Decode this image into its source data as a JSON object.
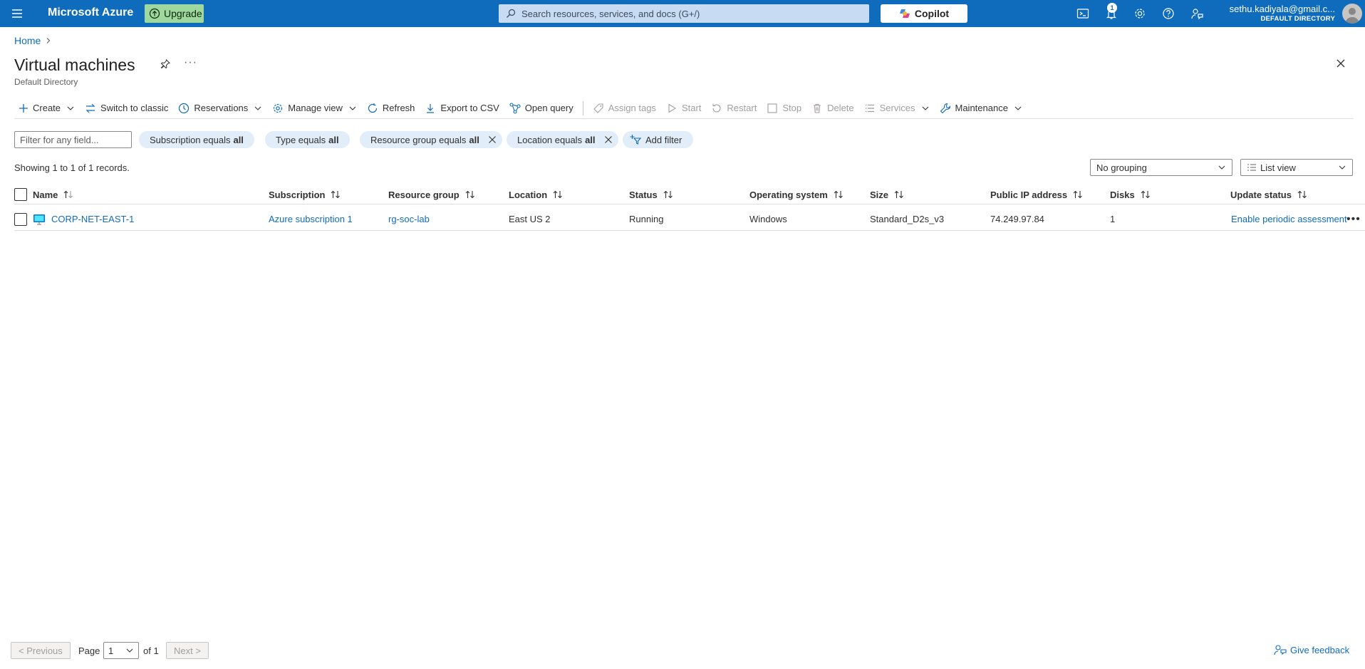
{
  "topbar": {
    "brand": "Microsoft Azure",
    "upgrade_label": "Upgrade",
    "search_placeholder": "Search resources, services, and docs (G+/)",
    "copilot_label": "Copilot",
    "notification_count": "1",
    "account_email": "sethu.kadiyala@gmail.c...",
    "account_directory": "DEFAULT DIRECTORY"
  },
  "breadcrumb": {
    "home": "Home"
  },
  "header": {
    "title": "Virtual machines",
    "subtitle": "Default Directory",
    "more": "···"
  },
  "commands": {
    "create": "Create",
    "switch_classic": "Switch to classic",
    "reservations": "Reservations",
    "manage_view": "Manage view",
    "refresh": "Refresh",
    "export_csv": "Export to CSV",
    "open_query": "Open query",
    "assign_tags": "Assign tags",
    "start": "Start",
    "restart": "Restart",
    "stop": "Stop",
    "delete": "Delete",
    "services": "Services",
    "maintenance": "Maintenance"
  },
  "filters": {
    "placeholder": "Filter for any field...",
    "subscription": {
      "label": "Subscription equals",
      "value": "all"
    },
    "type": {
      "label": "Type equals",
      "value": "all"
    },
    "resource_group": {
      "label": "Resource group equals",
      "value": "all"
    },
    "location": {
      "label": "Location equals",
      "value": "all"
    },
    "add_filter": "Add filter"
  },
  "records": {
    "count_text": "Showing 1 to 1 of 1 records.",
    "grouping": "No grouping",
    "view": "List view"
  },
  "table": {
    "columns": {
      "name": "Name",
      "subscription": "Subscription",
      "resource_group": "Resource group",
      "location": "Location",
      "status": "Status",
      "os": "Operating system",
      "size": "Size",
      "public_ip": "Public IP address",
      "disks": "Disks",
      "update_status": "Update status"
    },
    "rows": [
      {
        "name": "CORP-NET-EAST-1",
        "subscription": "Azure subscription 1",
        "resource_group": "rg-soc-lab",
        "location": "East US 2",
        "status": "Running",
        "os": "Windows",
        "size": "Standard_D2s_v3",
        "public_ip": "74.249.97.84",
        "disks": "1",
        "update_status": "Enable periodic assessment"
      }
    ]
  },
  "pager": {
    "previous": "< Previous",
    "page_label": "Page",
    "page_value": "1",
    "of_label": "of 1",
    "next": "Next >"
  },
  "feedback": "Give feedback",
  "icons": {
    "menu": "hamburger-icon",
    "search": "search-icon",
    "copilot": "copilot-icon",
    "cloud_shell": "cloud-shell-icon",
    "notifications": "bell-icon",
    "settings": "gear-icon",
    "help": "help-icon",
    "feedback": "feedback-icon"
  },
  "colors": {
    "topbar": "#0f6cbd",
    "upgrade": "#9fd89f",
    "pill": "#e1eefa",
    "link": "#0f6cbd"
  }
}
